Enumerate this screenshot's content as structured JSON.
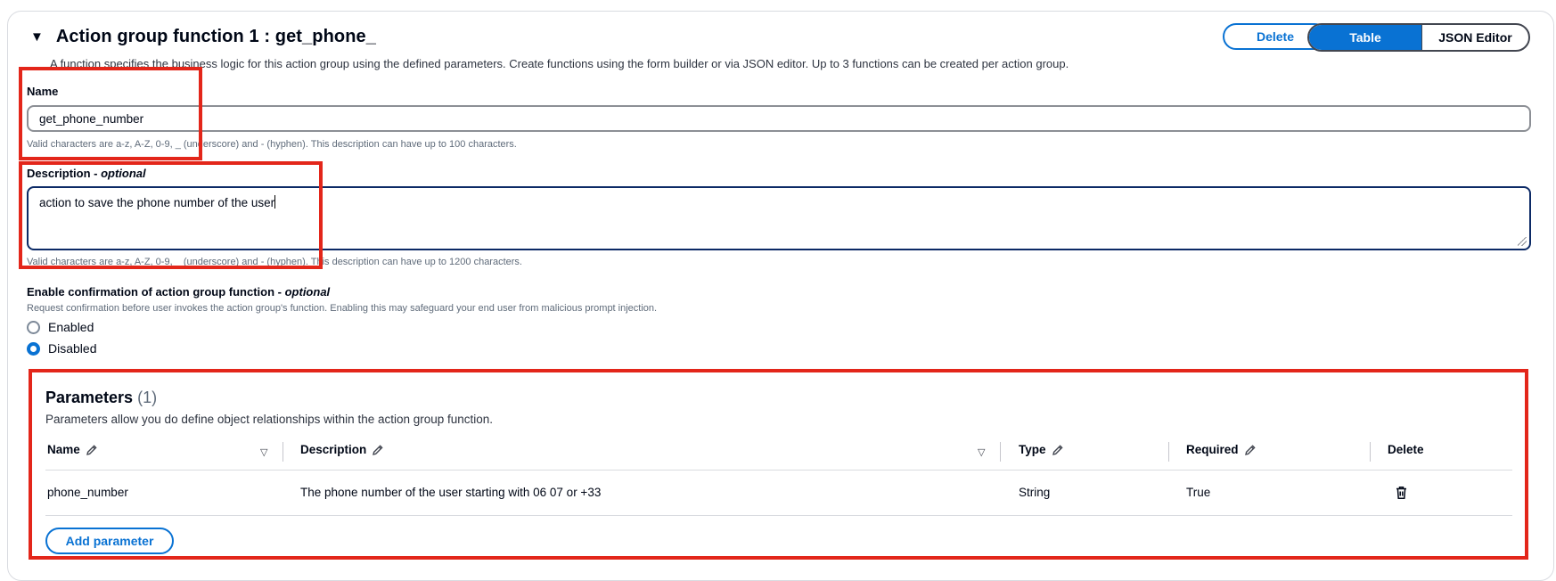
{
  "header": {
    "caret": "▼",
    "title": "Action group function 1 : get_phone_",
    "description": "A function specifies the business logic for this action group using the defined parameters. Create functions using the form builder or via JSON editor. Up to 3 functions can be created per action group.",
    "delete_label": "Delete",
    "tabs": [
      {
        "label": "Table",
        "selected": true
      },
      {
        "label": "JSON Editor",
        "selected": false
      }
    ]
  },
  "name_field": {
    "label": "Name",
    "value": "get_phone_number",
    "hint": "Valid characters are a-z, A-Z, 0-9, _ (underscore) and - (hyphen). This description can have up to 100 characters."
  },
  "description_field": {
    "label": "Description - ",
    "label_optional": "optional",
    "value": "action to save the phone number of the user",
    "hint": "Valid characters are a-z, A-Z, 0-9, _ (underscore) and - (hyphen). This description can have up to 1200 characters."
  },
  "confirmation": {
    "label": "Enable confirmation of action group function - ",
    "label_optional": "optional",
    "hint": "Request confirmation before user invokes the action group's function. Enabling this may safeguard your end user from malicious prompt injection.",
    "options": [
      {
        "label": "Enabled",
        "selected": false
      },
      {
        "label": "Disabled",
        "selected": true
      }
    ]
  },
  "parameters": {
    "title": "Parameters",
    "count": "(1)",
    "subtitle": "Parameters allow you do define object relationships within the action group function.",
    "columns": [
      "Name",
      "Description",
      "Type",
      "Required",
      "Delete"
    ],
    "rows": [
      {
        "name": "phone_number",
        "description": "The phone number of the user starting with 06 07 or +33",
        "type": "String",
        "required": "True"
      }
    ],
    "add_label": "Add parameter"
  },
  "colors": {
    "accent": "#0972d3",
    "highlight": "#e3261a",
    "focus_border": "#0c2a66"
  },
  "icons": [
    "triangle-down-icon",
    "pencil-icon",
    "filter-icon",
    "trash-icon"
  ]
}
